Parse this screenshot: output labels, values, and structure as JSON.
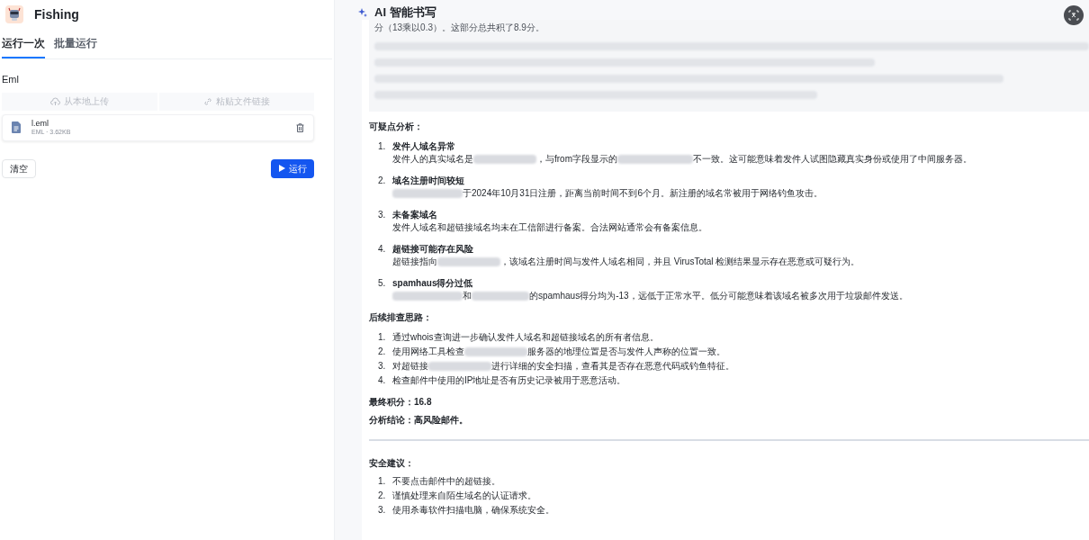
{
  "app": {
    "title": "Fishing"
  },
  "tabs": [
    {
      "label": "运行一次",
      "selected": true
    },
    {
      "label": "批量运行",
      "selected": false
    }
  ],
  "field_label": "Eml",
  "upload_options": [
    {
      "kind": "upload",
      "label": "从本地上传"
    },
    {
      "kind": "link",
      "label": "粘贴文件链接"
    }
  ],
  "file": {
    "name": "l.eml",
    "meta": "EML · 3.62KB"
  },
  "buttons": {
    "clear": "清空",
    "run": "运行"
  },
  "panel": {
    "title": "AI 智能书写",
    "quote": {
      "first_line": "分（13乘以0.3）。这部分总共积了8.9分。",
      "blurred_lines": [
        {
          "kind": "redacted"
        },
        {
          "kind": "redacted"
        },
        {
          "kind": "redacted"
        },
        {
          "kind": "redacted"
        }
      ]
    },
    "sections": [
      {
        "heading": "可疑点分析：",
        "items": [
          {
            "marker": "1.",
            "title": "发件人域名异常",
            "parts": [
              {
                "kind": "text",
                "text": "发件人的真实域名是"
              },
              {
                "kind": "redacted"
              },
              {
                "kind": "text",
                "text": "，与from字段显示的"
              },
              {
                "kind": "redacted"
              },
              {
                "kind": "text",
                "text": "不一致。这可能意味着发件人试图隐藏真实身份或使用了中间服务器。"
              }
            ]
          },
          {
            "marker": "2.",
            "title": "域名注册时间较短",
            "parts": [
              {
                "kind": "redacted"
              },
              {
                "kind": "text",
                "text": "于2024年10月31日注册，距离当前时间不到6个月。新注册的域名常被用于网络钓鱼攻击。"
              }
            ]
          },
          {
            "marker": "3.",
            "title": "未备案域名",
            "parts": [
              {
                "kind": "text",
                "text": "发件人域名和超链接域名均未在工信部进行备案。合法网站通常会有备案信息。"
              }
            ]
          },
          {
            "marker": "4.",
            "title": "超链接可能存在风险",
            "parts": [
              {
                "kind": "text",
                "text": "超链接指向"
              },
              {
                "kind": "redacted"
              },
              {
                "kind": "text",
                "text": "，该域名注册时间与发件人域名相同，并且 VirusTotal 检测结果显示存在恶意或可疑行为。"
              }
            ]
          },
          {
            "marker": "5.",
            "title": "spamhaus得分过低",
            "parts": [
              {
                "kind": "redacted"
              },
              {
                "kind": "text",
                "text": "和"
              },
              {
                "kind": "redacted"
              },
              {
                "kind": "text",
                "text": "的spamhaus得分均为-13，远低于正常水平。低分可能意味着该域名被多次用于垃圾邮件发送。"
              }
            ]
          }
        ]
      },
      {
        "heading": "后续排查思路：",
        "items": [
          {
            "marker": "1.",
            "parts": [
              {
                "kind": "text",
                "text": "通过whois查询进一步确认发件人域名和超链接域名的所有者信息。"
              }
            ]
          },
          {
            "marker": "2.",
            "parts": [
              {
                "kind": "text",
                "text": "使用网络工具检查"
              },
              {
                "kind": "redacted"
              },
              {
                "kind": "text",
                "text": "服务器的地理位置是否与发件人声称的位置一致。"
              }
            ]
          },
          {
            "marker": "3.",
            "parts": [
              {
                "kind": "text",
                "text": "对超链接"
              },
              {
                "kind": "redacted"
              },
              {
                "kind": "text",
                "text": "进行详细的安全扫描，查看其是否存在恶意代码或钓鱼特征。"
              }
            ]
          },
          {
            "marker": "4.",
            "parts": [
              {
                "kind": "text",
                "text": "检查邮件中使用的IP地址是否有历史记录被用于恶意活动。"
              }
            ]
          }
        ]
      }
    ],
    "score": "最终积分：16.8",
    "conclusion": "分析结论：高风险邮件。",
    "advice": {
      "heading": "安全建议：",
      "items": [
        {
          "marker": "1.",
          "parts": [
            {
              "kind": "text",
              "text": "不要点击邮件中的超链接。"
            }
          ]
        },
        {
          "marker": "2.",
          "parts": [
            {
              "kind": "text",
              "text": "谨慎处理来自陌生域名的认证请求。"
            }
          ]
        },
        {
          "marker": "3.",
          "parts": [
            {
              "kind": "text",
              "text": "使用杀毒软件扫描电脑，确保系统安全。"
            }
          ]
        }
      ]
    }
  }
}
